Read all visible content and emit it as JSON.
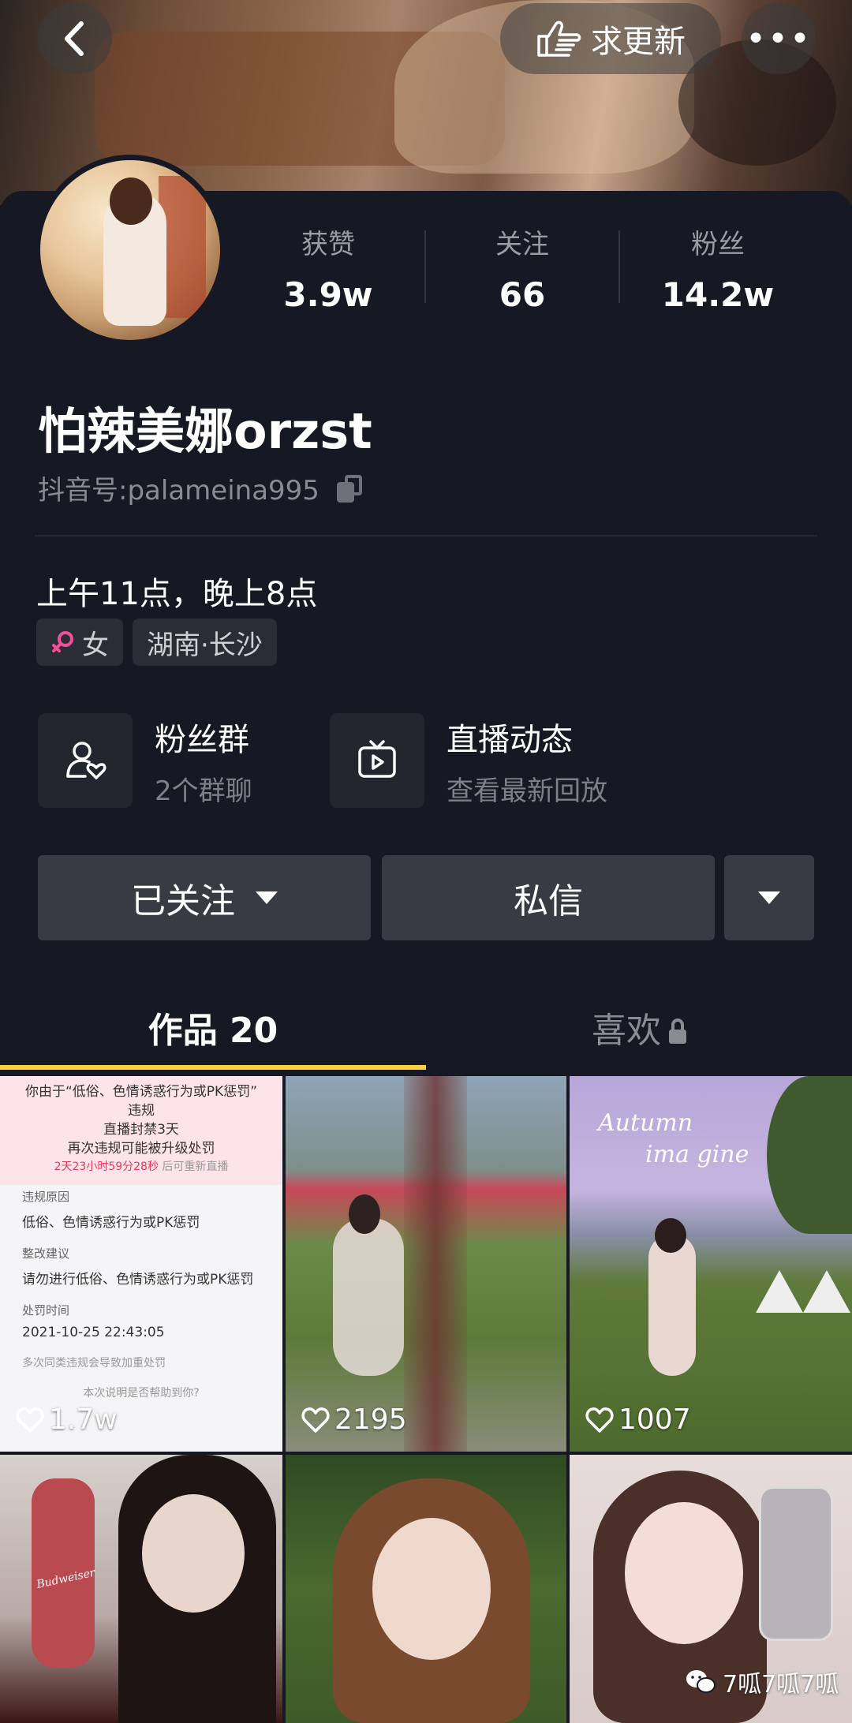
{
  "topbar": {
    "update_label": "求更新"
  },
  "profile": {
    "name": "怕辣美娜orzst",
    "douyin_id_label": "抖音号:",
    "douyin_id": "palameina995",
    "bio": "上午11点，晚上8点",
    "gender": "女",
    "location": "湖南·长沙"
  },
  "stats": [
    {
      "label": "获赞",
      "value": "3.9w"
    },
    {
      "label": "关注",
      "value": "66"
    },
    {
      "label": "粉丝",
      "value": "14.2w"
    }
  ],
  "cards": [
    {
      "title": "粉丝群",
      "subtitle": "2个群聊",
      "icon": "fan-group-icon"
    },
    {
      "title": "直播动态",
      "subtitle": "查看最新回放",
      "icon": "live-tv-icon"
    }
  ],
  "actions": {
    "followed": "已关注",
    "message": "私信"
  },
  "tabs": {
    "works": "作品 20",
    "likes": "喜欢"
  },
  "videos": [
    {
      "likes": "1.7w"
    },
    {
      "likes": "2195"
    },
    {
      "likes": "1007"
    },
    {
      "likes": ""
    },
    {
      "likes": ""
    },
    {
      "likes": ""
    }
  ],
  "notice": {
    "title_line1": "你由于“低俗、色情诱惑行为或PK惩罚”",
    "title_line2": "违规",
    "title_line3": "直播封禁3天",
    "title_line4": "再次违规可能被升级处罚",
    "countdown": "2天23小时59分28秒",
    "countdown_suffix": "后可重新直播",
    "reason_label": "违规原因",
    "reason": "低俗、色情诱惑行为或PK惩罚",
    "advice_label": "整改建议",
    "advice": "请勿进行低俗、色情诱惑行为或PK惩罚",
    "time_label": "处罚时间",
    "time": "2021-10-25 22:43:05",
    "warning": "多次同类违规会导致加重处罚",
    "helpful": "本次说明是否帮助到你?"
  },
  "autumn_text": {
    "line1": "Autumn",
    "line2": "ima gine"
  },
  "bottle_label": "Budweiser",
  "watermark": "7呱7呱7呱",
  "colors": {
    "background": "#161823",
    "accent": "#fcd13c",
    "female": "#f0509a"
  }
}
